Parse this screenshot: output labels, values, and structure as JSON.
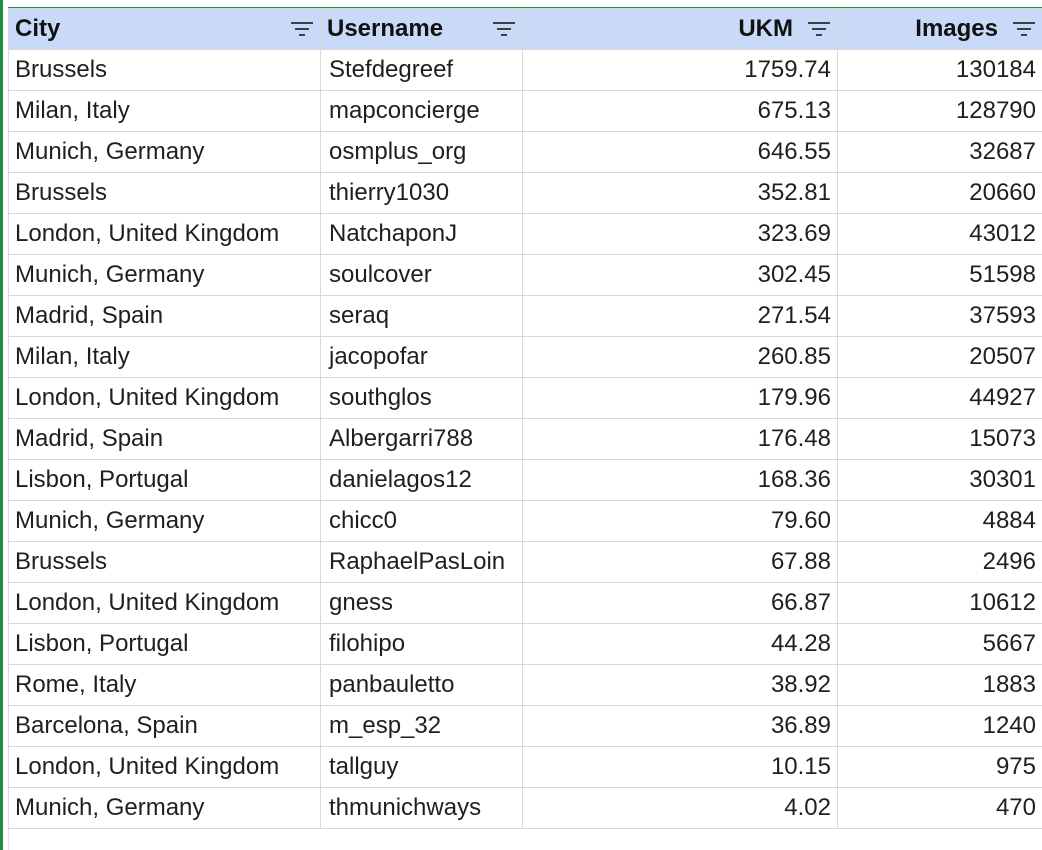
{
  "columns": {
    "city": "City",
    "username": "Username",
    "ukm": "UKM",
    "images": "Images"
  },
  "rows": [
    {
      "city": "Brussels",
      "username": "Stefdegreef",
      "ukm": "1759.74",
      "images": "130184"
    },
    {
      "city": "Milan, Italy",
      "username": "mapconcierge",
      "ukm": "675.13",
      "images": "128790"
    },
    {
      "city": "Munich, Germany",
      "username": "osmplus_org",
      "ukm": "646.55",
      "images": "32687"
    },
    {
      "city": "Brussels",
      "username": "thierry1030",
      "ukm": "352.81",
      "images": "20660"
    },
    {
      "city": "London, United Kingdom",
      "username": "NatchaponJ",
      "ukm": "323.69",
      "images": "43012"
    },
    {
      "city": "Munich, Germany",
      "username": "soulcover",
      "ukm": "302.45",
      "images": "51598"
    },
    {
      "city": "Madrid, Spain",
      "username": "seraq",
      "ukm": "271.54",
      "images": "37593"
    },
    {
      "city": "Milan, Italy",
      "username": "jacopofar",
      "ukm": "260.85",
      "images": "20507"
    },
    {
      "city": "London, United Kingdom",
      "username": "southglos",
      "ukm": "179.96",
      "images": "44927"
    },
    {
      "city": "Madrid, Spain",
      "username": "Albergarri788",
      "ukm": "176.48",
      "images": "15073"
    },
    {
      "city": "Lisbon, Portugal",
      "username": "danielagos12",
      "ukm": "168.36",
      "images": "30301"
    },
    {
      "city": "Munich, Germany",
      "username": "chicc0",
      "ukm": "79.60",
      "images": "4884"
    },
    {
      "city": "Brussels",
      "username": "RaphaelPasLoin",
      "ukm": "67.88",
      "images": "2496"
    },
    {
      "city": "London, United Kingdom",
      "username": "gness",
      "ukm": "66.87",
      "images": "10612"
    },
    {
      "city": "Lisbon, Portugal",
      "username": "filohipo",
      "ukm": "44.28",
      "images": "5667"
    },
    {
      "city": "Rome, Italy",
      "username": "panbauletto",
      "ukm": "38.92",
      "images": "1883"
    },
    {
      "city": "Barcelona, Spain",
      "username": "m_esp_32",
      "ukm": "36.89",
      "images": "1240"
    },
    {
      "city": "London, United Kingdom",
      "username": "tallguy",
      "ukm": "10.15",
      "images": "975"
    },
    {
      "city": "Munich, Germany",
      "username": "thmunichways",
      "ukm": "4.02",
      "images": "470"
    }
  ],
  "icons": {
    "filter": "filter-icon"
  },
  "colors": {
    "header_bg": "#c9daf8",
    "selection": "#1e8e3e",
    "gridline": "#d9d9d9"
  }
}
